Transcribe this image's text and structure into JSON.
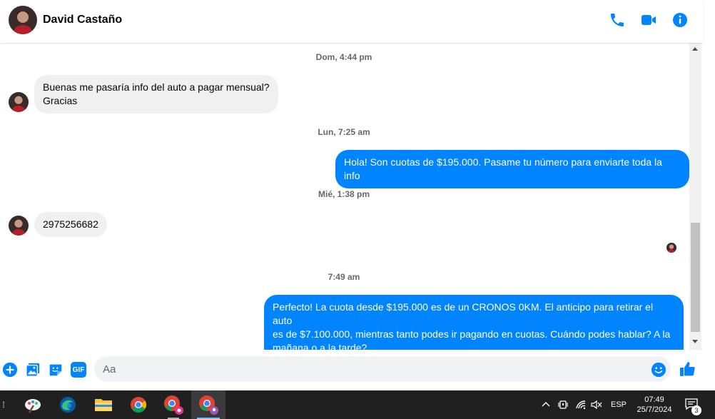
{
  "header": {
    "contact_name": "David Castaño",
    "icons": [
      "phone-icon",
      "video-call-icon",
      "info-icon"
    ],
    "accent_color": "#0084ff"
  },
  "messages": {
    "timestamps": [
      "Dom, 4:44 pm",
      "Lun, 7:25 am",
      "Mié, 1:38 pm",
      "7:49 am"
    ],
    "msg1": {
      "line1": "Buenas me pasaría info del auto a pagar mensual?",
      "line2": "Gracias"
    },
    "msg2": "Hola! Son cuotas de $195.000. Pasame tu número para enviarte toda la info",
    "msg3": "2975256682",
    "msg4": {
      "line1": "Perfecto! La cuota desde $195.000 es de un CRONOS 0KM. El anticipo para retirar el auto",
      "line2": "es de $7.100.000, mientras tanto podes ir pagando en cuotas. Cuándo podes hablar? A la",
      "line3": "mañana o a la tarde?"
    }
  },
  "composer": {
    "placeholder": "Aa",
    "icons": [
      "plus-icon",
      "image-icon",
      "sticker-icon",
      "gif-icon",
      "emoji-icon",
      "like-icon"
    ],
    "gif_label": "GIF"
  },
  "taskbar": {
    "language": "ESP",
    "time": "07:49",
    "date": "25/7/2024",
    "notification_count": "3"
  }
}
